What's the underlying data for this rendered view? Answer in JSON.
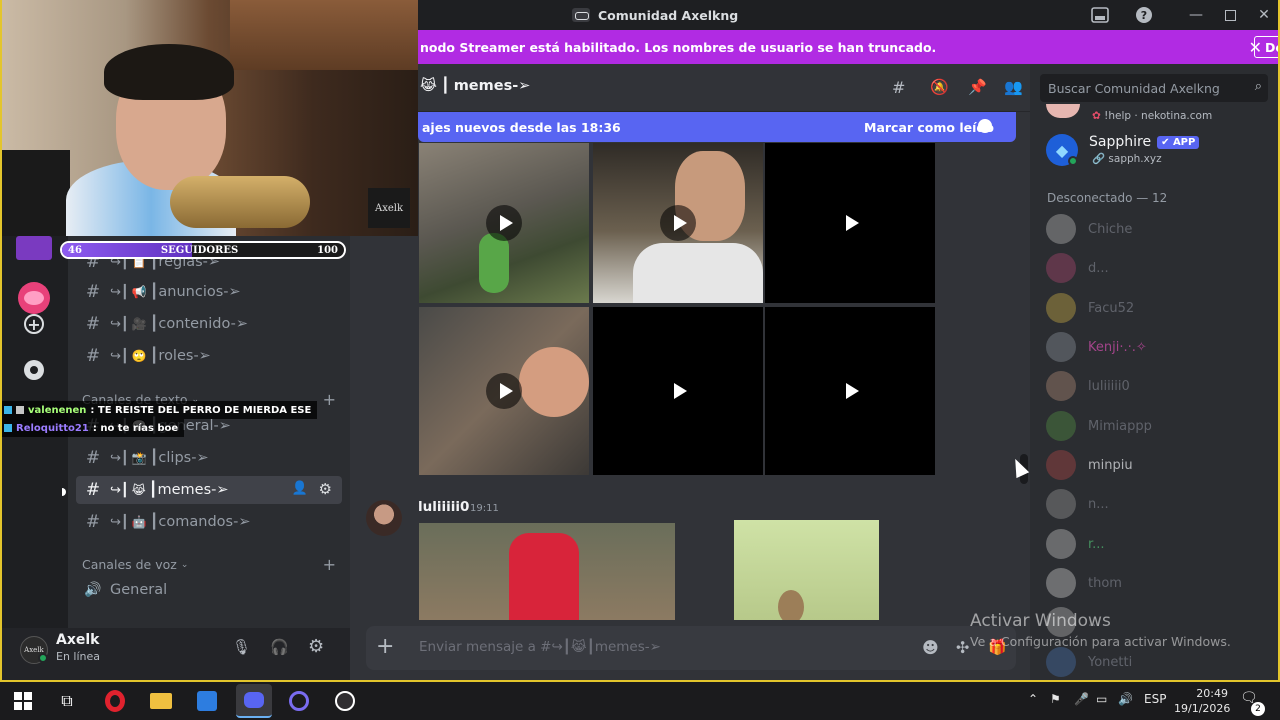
{
  "window": {
    "title": "Comunidad Axelkng"
  },
  "banner": {
    "text": "nodo Streamer está habilitado. Los nombres de usuario se han truncado.",
    "button": "Deshabilitar"
  },
  "stream_overlay": {
    "follower_label": "SEGUIDORES",
    "follower_current": "46",
    "follower_goal": "100",
    "follower_progress": 0.46,
    "chat": [
      {
        "user": "valenenen",
        "text": ": TE REISTE DEL PERRO DE MIERDA ESE",
        "color": "#a8ff7a"
      },
      {
        "user": "Reloquitto21",
        "text": ": no te rías boe",
        "color": "#9b7cff"
      }
    ],
    "cam_logo": "Axelk"
  },
  "channels": {
    "top_items": [
      {
        "label": "reglas-➢",
        "emoji": "📋"
      },
      {
        "label": "anuncios-➢",
        "emoji": "📢"
      },
      {
        "label": "contenido-➢",
        "emoji": "🎥"
      },
      {
        "label": "roles-➢",
        "emoji": "🙄"
      }
    ],
    "text_category": "Canales de texto",
    "text_items": [
      {
        "label": "general-➢",
        "emoji": "💬"
      },
      {
        "label": "clips-➢",
        "emoji": "📸"
      },
      {
        "label": "memes-➢",
        "emoji": "😹",
        "active": true
      },
      {
        "label": "comandos-➢",
        "emoji": "🤖"
      }
    ],
    "voice_category": "Canales de voz",
    "voice_items": [
      {
        "label": "General"
      }
    ]
  },
  "user": {
    "name": "Axelk",
    "status": "En línea"
  },
  "chat": {
    "channel_title": "memes-➢",
    "channel_emoji": "😹",
    "new_messages": "ajes nuevos desde las 18:36",
    "mark_read": "Marcar como leído",
    "message_author": "luliiiii0",
    "message_time": "19:11",
    "composer_placeholder": "Enviar mensaje a #↪┃😹┃memes-➢"
  },
  "members": {
    "search_placeholder": "Buscar Comunidad Axelkng",
    "bot_prev_activity": "!help · nekotina.com",
    "bot_name": "Sapphire",
    "bot_badge": "✔ APP",
    "bot_activity": "sapph.xyz",
    "offline_header": "Desconectado — 12",
    "offline": [
      "Chiche",
      "d...",
      "Facu52",
      "Kenji·.·.✧",
      "luliiiii0",
      "Mimiappp",
      "minpiu",
      "n...",
      "r...",
      "thom",
      "...",
      "Yonetti"
    ]
  },
  "watermark": {
    "title": "Activar Windows",
    "subtitle": "Ve a Configuración para activar Windows."
  },
  "taskbar": {
    "lang": "ESP",
    "time": "20:49",
    "date": "19/1/2026",
    "notifications": "2"
  },
  "colors": {
    "accent": "#5865f2",
    "streamer_banner": "#b12be3",
    "frame": "#e3c52c"
  }
}
